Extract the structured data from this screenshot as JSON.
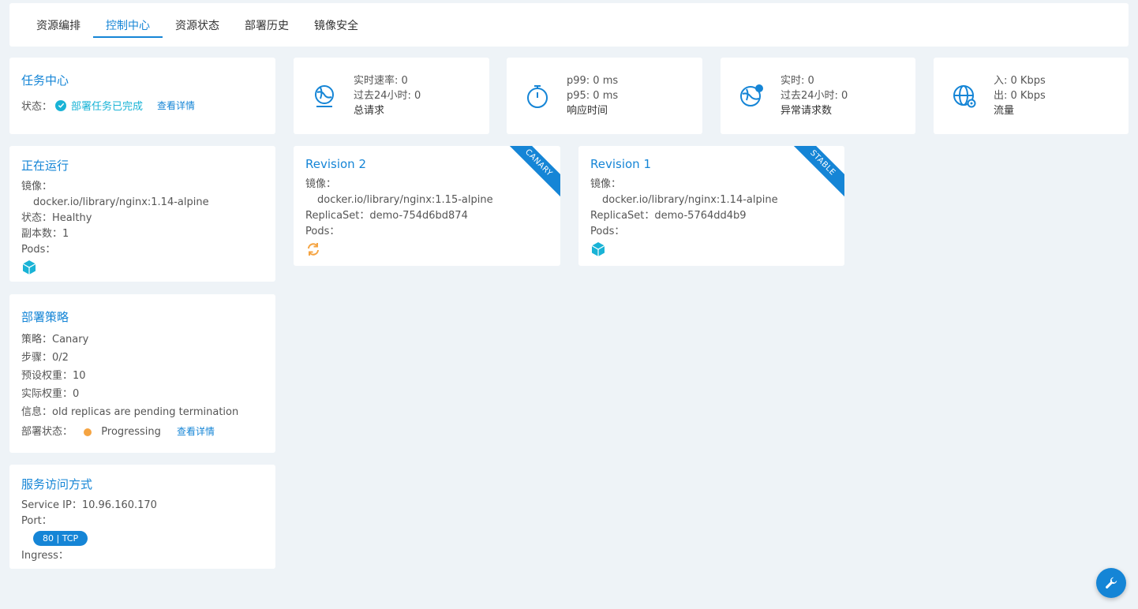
{
  "tabs": [
    {
      "label": "资源编排",
      "active": false
    },
    {
      "label": "控制中心",
      "active": true
    },
    {
      "label": "资源状态",
      "active": false
    },
    {
      "label": "部署历史",
      "active": false
    },
    {
      "label": "镜像安全",
      "active": false
    }
  ],
  "task": {
    "title": "任务中心",
    "status_label": "状态：",
    "status_text": "部署任务已完成",
    "detail_link": "查看详情"
  },
  "metrics": {
    "requests": {
      "line1": "实时速率: 0",
      "line2": "过去24小时: 0",
      "label": "总请求"
    },
    "latency": {
      "line1": "p99: 0 ms",
      "line2": "p95: 0 ms",
      "label": "响应时间"
    },
    "errors": {
      "line1": "实时: 0",
      "line2": "过去24小时: 0",
      "label": "异常请求数"
    },
    "traffic": {
      "line1": "入: 0 Kbps",
      "line2": "出: 0 Kbps",
      "label": "流量"
    }
  },
  "running": {
    "title": "正在运行",
    "image_label": "镜像：",
    "image_value": "docker.io/library/nginx:1.14-alpine",
    "status": "状态：Healthy",
    "replicas": "副本数：1",
    "pods_label": "Pods："
  },
  "strategy": {
    "title": "部署策略",
    "policy": "策略：Canary",
    "steps": "步骤：0/2",
    "preset_weight": "预设权重：10",
    "actual_weight": "实际权重：0",
    "info": "信息：old replicas are pending termination",
    "deploy_status_label": "部署状态：",
    "deploy_status_value": "Progressing",
    "detail_link": "查看详情"
  },
  "service": {
    "title": "服务访问方式",
    "ip": "Service IP：10.96.160.170",
    "port_label": "Port：",
    "port_badge": "80 | TCP",
    "ingress_label": "Ingress："
  },
  "revisions": [
    {
      "title": "Revision 2",
      "ribbon": "CANARY",
      "image_label": "镜像：",
      "image_value": "docker.io/library/nginx:1.15-alpine",
      "replicaset": "ReplicaSet：demo-754d6bd874",
      "pods_label": "Pods：",
      "pod_state": "updating"
    },
    {
      "title": "Revision 1",
      "ribbon": "STABLE",
      "image_label": "镜像：",
      "image_value": "docker.io/library/nginx:1.14-alpine",
      "replicaset": "ReplicaSet：demo-5764dd4b9",
      "pods_label": "Pods：",
      "pod_state": "running"
    }
  ],
  "colors": {
    "accent": "#1585d6",
    "success": "#19b3d6",
    "warning": "#f5a442",
    "background": "#eef3f7"
  }
}
